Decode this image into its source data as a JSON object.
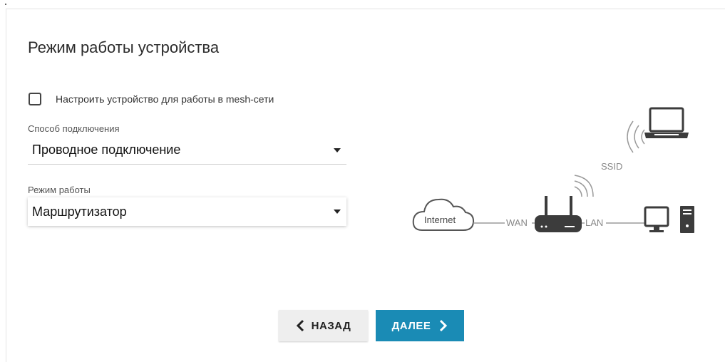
{
  "page": {
    "title": "Режим работы устройства"
  },
  "mesh": {
    "label": "Настроить устройство для работы в mesh-сети",
    "checked": false
  },
  "connection": {
    "label": "Способ подключения",
    "value": "Проводное подключение"
  },
  "mode": {
    "label": "Режим работы",
    "value": "Маршрутизатор"
  },
  "diagram": {
    "internet": "Internet",
    "wan": "WAN",
    "lan": "LAN",
    "ssid": "SSID"
  },
  "buttons": {
    "back": "НАЗАД",
    "next": "ДАЛЕЕ"
  },
  "colors": {
    "accent": "#1a8bb5",
    "back_button": "#eeeeee",
    "diagram_dark": "#3c3c3c",
    "diagram_light": "#9a9a9a"
  }
}
